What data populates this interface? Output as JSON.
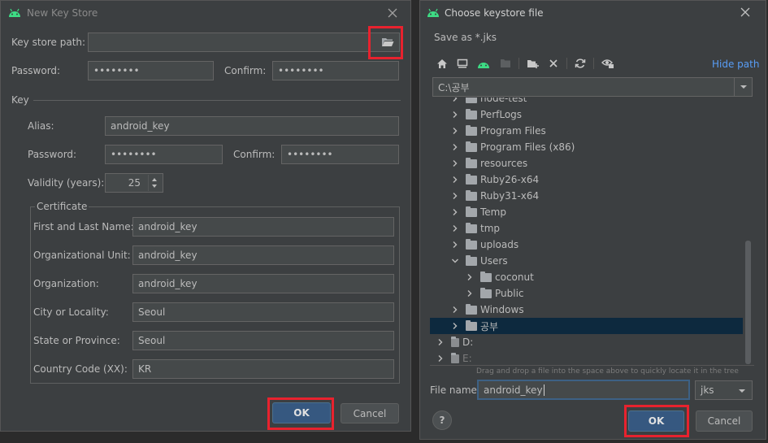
{
  "left_dialog": {
    "title": "New Key Store",
    "key_store_path_label": "Key store path:",
    "key_store_path_value": "",
    "password_label": "Password:",
    "password_value": "••••••••",
    "confirm_label": "Confirm:",
    "confirm_value": "••••••••",
    "key_group_label": "Key",
    "alias_label": "Alias:",
    "alias_value": "android_key",
    "key_password_label": "Password:",
    "key_password_value": "••••••••",
    "key_confirm_label": "Confirm:",
    "key_confirm_value": "••••••••",
    "validity_label": "Validity (years):",
    "validity_value": "25",
    "certificate_label": "Certificate",
    "cert_fields": [
      {
        "label": "First and Last Name:",
        "value": "android_key"
      },
      {
        "label": "Organizational Unit:",
        "value": "android_key"
      },
      {
        "label": "Organization:",
        "value": "android_key"
      },
      {
        "label": "City or Locality:",
        "value": "Seoul"
      },
      {
        "label": "State or Province:",
        "value": "Seoul"
      },
      {
        "label": "Country Code (XX):",
        "value": "KR"
      }
    ],
    "ok_label": "OK",
    "cancel_label": "Cancel"
  },
  "right_dialog": {
    "title": "Choose keystore file",
    "subtitle": "Save as *.jks",
    "hide_path_label": "Hide path",
    "path_value": "C:\\공부",
    "tree": [
      {
        "label": "node-test",
        "indent": 1,
        "expanded": false
      },
      {
        "label": "PerfLogs",
        "indent": 1,
        "expanded": false
      },
      {
        "label": "Program Files",
        "indent": 1,
        "expanded": false
      },
      {
        "label": "Program Files (x86)",
        "indent": 1,
        "expanded": false
      },
      {
        "label": "resources",
        "indent": 1,
        "expanded": false
      },
      {
        "label": "Ruby26-x64",
        "indent": 1,
        "expanded": false
      },
      {
        "label": "Ruby31-x64",
        "indent": 1,
        "expanded": false
      },
      {
        "label": "Temp",
        "indent": 1,
        "expanded": false
      },
      {
        "label": "tmp",
        "indent": 1,
        "expanded": false
      },
      {
        "label": "uploads",
        "indent": 1,
        "expanded": false
      },
      {
        "label": "Users",
        "indent": 1,
        "expanded": true
      },
      {
        "label": "coconut",
        "indent": 2,
        "expanded": false
      },
      {
        "label": "Public",
        "indent": 2,
        "expanded": false
      },
      {
        "label": "Windows",
        "indent": 1,
        "expanded": false
      },
      {
        "label": "공부",
        "indent": 1,
        "expanded": false,
        "selected": true
      },
      {
        "label": "D:",
        "indent": 0,
        "expanded": false,
        "drive": true
      },
      {
        "label": "E:",
        "indent": 0,
        "expanded": false,
        "drive": true
      }
    ],
    "drag_hint": "Drag and drop a file into the space above to quickly locate it in the tree",
    "file_name_label": "File name:",
    "file_name_value": "android_key",
    "extension_value": "jks",
    "help_label": "?",
    "ok_label": "OK",
    "cancel_label": "Cancel"
  },
  "colors": {
    "dialog_bg": "#3c3f41",
    "field_bg": "#45494a",
    "primary_button": "#365880",
    "selection": "#0d293e",
    "highlight_box": "#e8222e",
    "android_green": "#3ddc84",
    "link_blue": "#589df6"
  }
}
